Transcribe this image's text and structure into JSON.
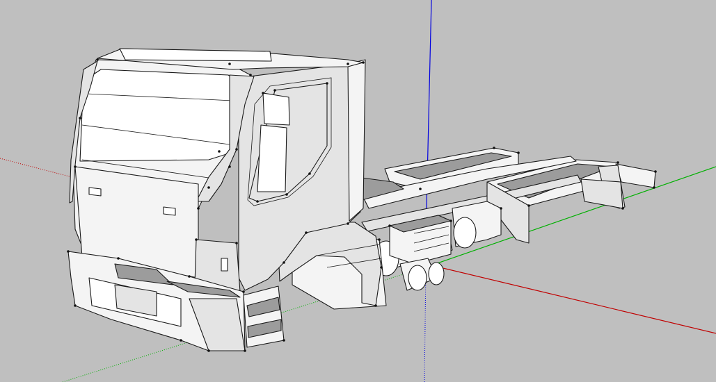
{
  "window": {
    "title": ""
  },
  "viewport": {
    "background": "#bfbfbf",
    "axes": {
      "red": "#c00000",
      "green": "#00b000",
      "blue": "#0000e0",
      "inferred_dotted": true
    },
    "model": {
      "kind": "truck-chassis-cab",
      "render_style": "hidden-line-white-faces",
      "face_colors": {
        "light": "#f4f4f4",
        "mid": "#e4e4e4",
        "dark": "#9c9c9c"
      }
    }
  }
}
